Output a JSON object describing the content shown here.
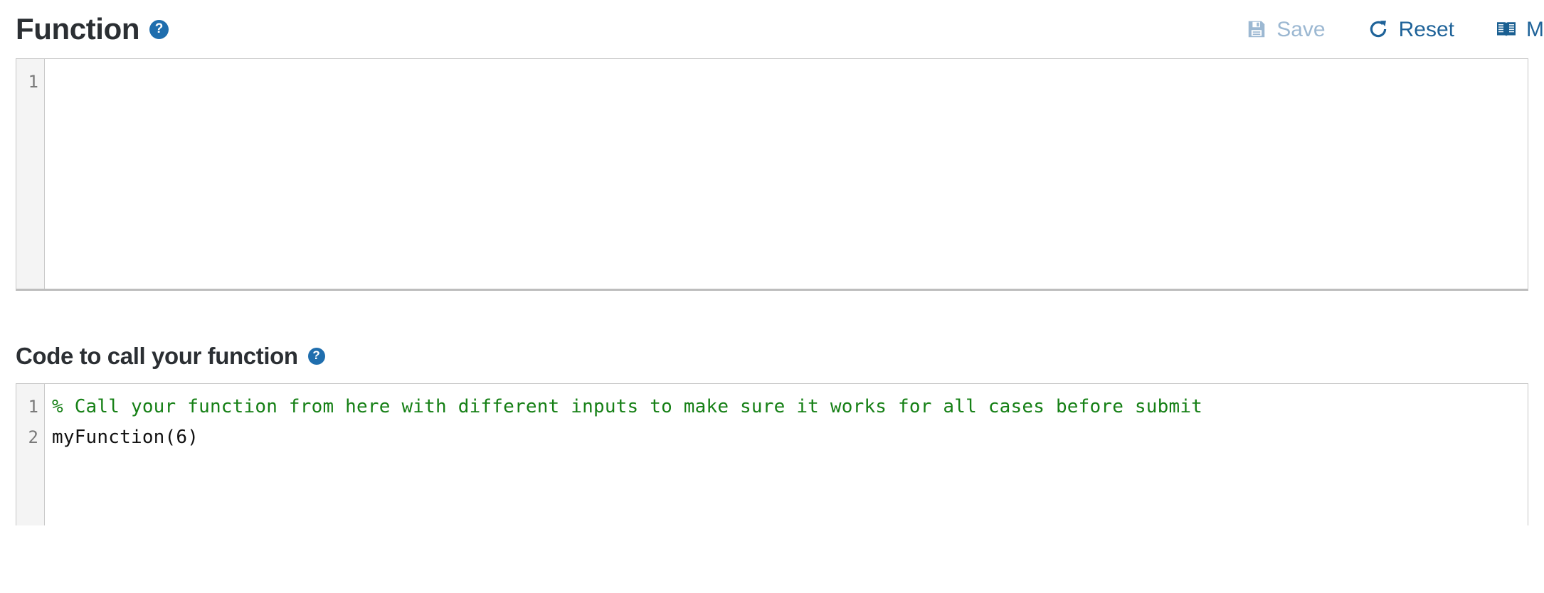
{
  "function_section": {
    "title": "Function",
    "help_icon": "help-circle-icon",
    "help_glyph": "?",
    "editor": {
      "line_numbers": [
        "1"
      ],
      "lines": [
        ""
      ]
    }
  },
  "toolbar": {
    "save": {
      "label": "Save",
      "icon": "floppy-disk-save-icon",
      "enabled": false,
      "color": "#9cb8d2"
    },
    "reset": {
      "label": "Reset",
      "icon": "circular-refresh-reset-icon",
      "enabled": true,
      "color": "#1f6399"
    },
    "docs": {
      "label": "M",
      "icon": "open-book-documentation-icon",
      "enabled": true,
      "color": "#1a5f91"
    }
  },
  "call_section": {
    "title": "Code to call your function",
    "help_icon": "help-circle-icon",
    "help_glyph": "?",
    "editor": {
      "line_numbers": [
        "1",
        "2"
      ],
      "lines": [
        "% Call your function from here with different inputs to make sure it works for all cases before submit",
        "myFunction(6)"
      ]
    }
  },
  "colors": {
    "accent_blue": "#1f6eae",
    "link_blue": "#1f6399",
    "disabled_blue": "#9cb8d2",
    "comment_green": "#168016",
    "code_black": "#111111",
    "heading": "#2b2f33",
    "gutter_bg": "#f4f4f4",
    "border": "#c6c6c6"
  }
}
